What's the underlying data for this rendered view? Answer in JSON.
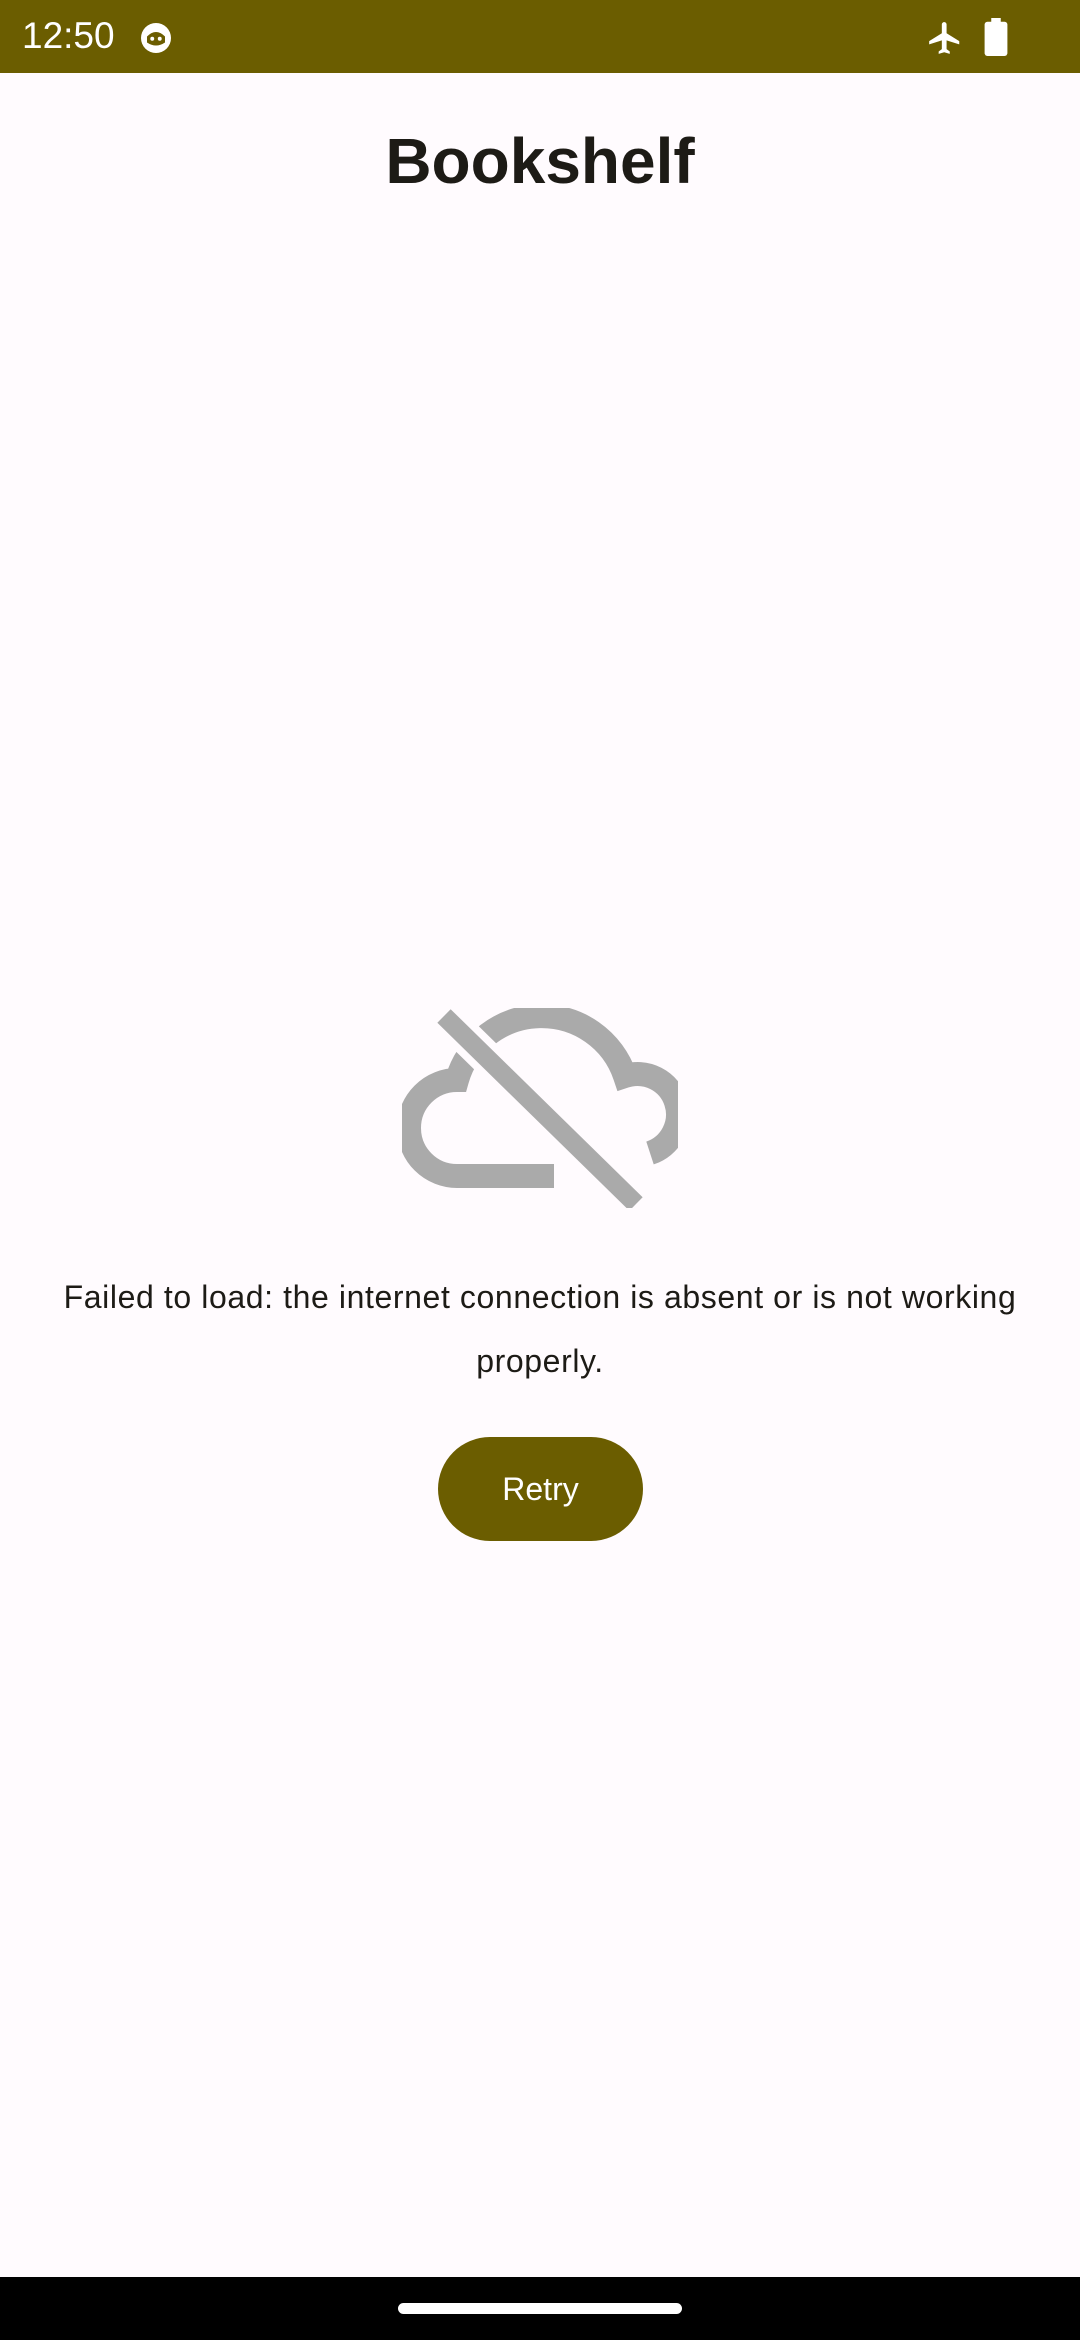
{
  "status_bar": {
    "time": "12:50",
    "icons": [
      "app-notification-icon",
      "airplane-mode-icon",
      "battery-icon"
    ],
    "background_color": "#6b5d00"
  },
  "header": {
    "title": "Bookshelf"
  },
  "error_state": {
    "icon": "cloud-off-icon",
    "message": "Failed to load: the internet connection is absent or is not working properly.",
    "retry_label": "Retry",
    "icon_color": "#aaaaaa"
  },
  "theme": {
    "primary": "#6b5d00",
    "background": "#fffbfe",
    "on_surface": "#1d1b16"
  },
  "navigation": {
    "icons": [
      "home-handle"
    ]
  }
}
